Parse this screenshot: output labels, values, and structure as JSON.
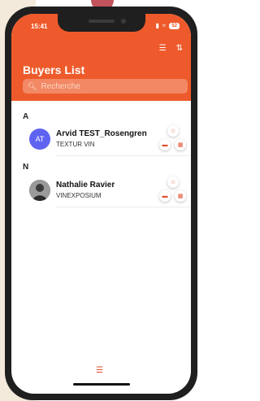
{
  "status_bar": {
    "time": "15:41",
    "battery": "52"
  },
  "header": {
    "title": "Buyers List",
    "filter_icon": "filter-icon",
    "sort_icon": "sort-icon"
  },
  "search": {
    "placeholder": "Recherche"
  },
  "sections": [
    {
      "letter": "A",
      "buyers": [
        {
          "initials": "AT",
          "name": "Arvid TEST_Rosengren",
          "company": "TEXTUR VIN"
        }
      ]
    },
    {
      "letter": "N",
      "buyers": [
        {
          "initials": "",
          "name": "Nathalie Ravier",
          "company": "VINEXPOSIUM"
        }
      ]
    }
  ],
  "colors": {
    "primary": "#ee5a2b",
    "avatar": "#5f63f2"
  }
}
